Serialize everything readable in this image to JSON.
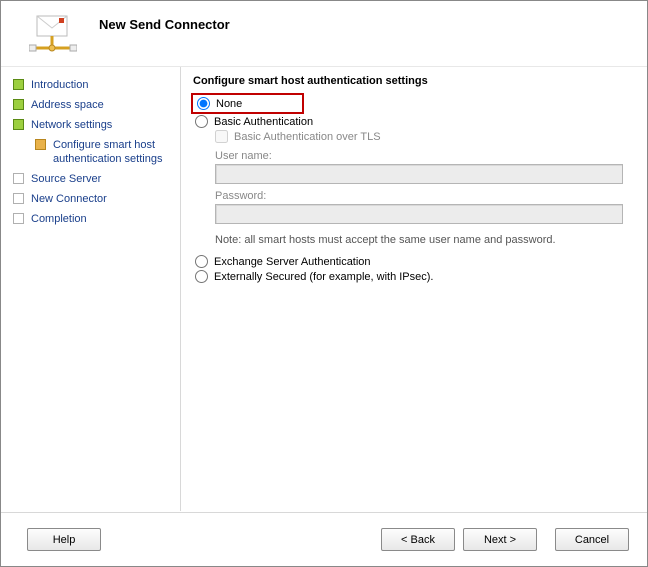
{
  "header": {
    "title": "New Send Connector"
  },
  "sidebar": {
    "steps": [
      {
        "label": "Introduction",
        "state": "done"
      },
      {
        "label": "Address space",
        "state": "done"
      },
      {
        "label": "Network settings",
        "state": "done"
      },
      {
        "label": "Configure smart host authentication settings",
        "state": "current",
        "sub": true
      },
      {
        "label": "Source Server",
        "state": "pending"
      },
      {
        "label": "New Connector",
        "state": "pending"
      },
      {
        "label": "Completion",
        "state": "pending"
      }
    ]
  },
  "main": {
    "section_title": "Configure smart host authentication settings",
    "options": {
      "none": "None",
      "basic": "Basic Authentication",
      "basic_tls": "Basic Authentication over TLS",
      "username_label": "User name:",
      "password_label": "Password:",
      "note": "Note: all smart hosts must accept the same user name and password.",
      "exchange": "Exchange Server Authentication",
      "external": "Externally Secured (for example, with IPsec)."
    },
    "selected": "none",
    "username_value": "",
    "password_value": ""
  },
  "footer": {
    "help": "Help",
    "back": "< Back",
    "next": "Next >",
    "cancel": "Cancel"
  }
}
